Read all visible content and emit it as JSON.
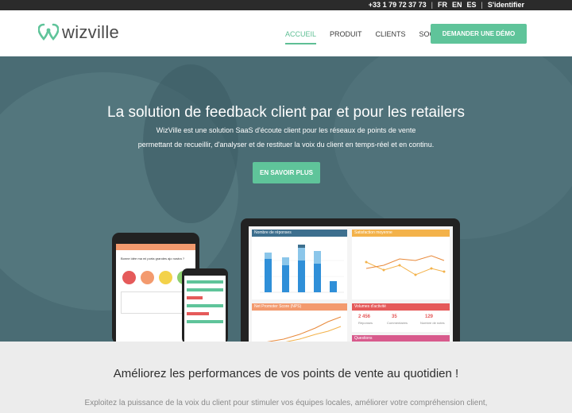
{
  "topbar": {
    "phone": "+33 1 79 72 37 73",
    "languages": [
      "FR",
      "EN",
      "ES"
    ],
    "login": "S'identifier"
  },
  "header": {
    "logo_text": "wizville",
    "nav": [
      {
        "label": "ACCUEIL",
        "active": true
      },
      {
        "label": "PRODUIT",
        "active": false
      },
      {
        "label": "CLIENTS",
        "active": false
      },
      {
        "label": "SOCIÉTÉ",
        "active": false
      }
    ],
    "demo_button": "DEMANDER UNE DÉMO"
  },
  "hero": {
    "title": "La solution de feedback client par et pour les retailers",
    "subtitle_line1": "WizVille est une solution SaaS d'écoute client pour les réseaux de points de vente",
    "subtitle_line2": "permettant de recueillir, d'analyser et de restituer la voix du client en temps-réel et en continu.",
    "cta": "EN SAVOIR PLUS"
  },
  "dashboard": {
    "panel1_title": "Nombre de réponses",
    "panel2_title": "Satisfaction moyenne",
    "panel3_title": "Net Promoter Score (NPS)",
    "panel4_title": "Volumes d'activité",
    "panel5_title": "Questions",
    "stats": [
      {
        "value": "2 456",
        "label": "Réponses"
      },
      {
        "value": "35",
        "label": "Commentaires"
      },
      {
        "value": "129",
        "label": "Nombre de notes"
      }
    ],
    "tablet_question": "Bonne idée ma mi porta grandes ajo nostra ?"
  },
  "lower": {
    "title": "Améliorez les performances de vos points de vente au quotidien !",
    "text": "Exploitez la puissance de la voix du client pour stimuler vos équipes locales, améliorer votre compréhension client,"
  },
  "colors": {
    "accent": "#5fc49a",
    "hero_bg": "#4a6c74",
    "topbar_bg": "#2b2b2b"
  }
}
